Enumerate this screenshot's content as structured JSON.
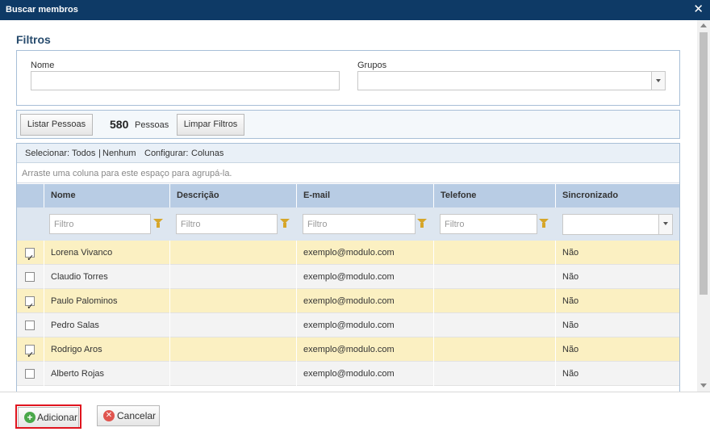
{
  "window": {
    "title": "Buscar membros",
    "close_glyph": "✕"
  },
  "filters": {
    "title": "Filtros",
    "name_label": "Nome",
    "name_value": "",
    "groups_label": "Grupos",
    "groups_value": ""
  },
  "toolbar": {
    "list_button": "Listar Pessoas",
    "count": "580",
    "count_label": "Pessoas",
    "clear_button": "Limpar Filtros"
  },
  "grid": {
    "select_prefix": "Selecionar:",
    "select_all": "Todos",
    "separator": "|",
    "select_none": "Nenhum",
    "config_prefix": "Configurar:",
    "columns_link": "Colunas",
    "group_hint": "Arraste uma coluna para este espaço para agrupá-la.",
    "headers": {
      "name": "Nome",
      "description": "Descrição",
      "email": "E-mail",
      "phone": "Telefone",
      "synced": "Sincronizado"
    },
    "filter_placeholder": "Filtro",
    "rows": [
      {
        "selected": true,
        "name": "Lorena Vivanco",
        "description": "",
        "email": "exemplo@modulo.com",
        "phone": "",
        "synced": "Não"
      },
      {
        "selected": false,
        "name": "Claudio Torres",
        "description": "",
        "email": "exemplo@modulo.com",
        "phone": "",
        "synced": "Não"
      },
      {
        "selected": true,
        "name": "Paulo Palominos",
        "description": "",
        "email": "exemplo@modulo.com",
        "phone": "",
        "synced": "Não"
      },
      {
        "selected": false,
        "name": "Pedro Salas",
        "description": "",
        "email": "exemplo@modulo.com",
        "phone": "",
        "synced": "Não"
      },
      {
        "selected": true,
        "name": "Rodrigo Aros",
        "description": "",
        "email": "exemplo@modulo.com",
        "phone": "",
        "synced": "Não"
      },
      {
        "selected": false,
        "name": "Alberto Rojas",
        "description": "",
        "email": "exemplo@modulo.com",
        "phone": "",
        "synced": "Não"
      }
    ]
  },
  "footer": {
    "add_button": "Adicionar",
    "add_icon": "plus-circle-icon",
    "cancel_button": "Cancelar",
    "cancel_icon": "x-circle-icon"
  },
  "colors": {
    "titlebar": "#0e3a66",
    "selected_row": "#fbf0c2",
    "header_bg": "#b8cce4",
    "highlight": "#e0141e"
  }
}
